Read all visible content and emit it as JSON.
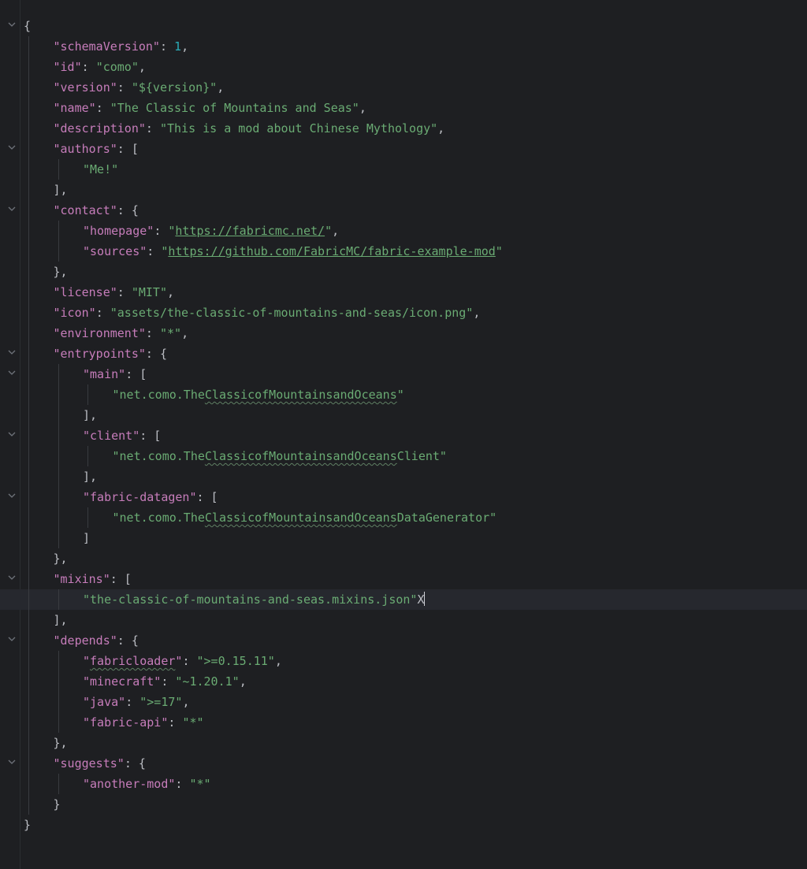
{
  "editor": {
    "theme_colors": {
      "background": "#1e1f22",
      "key": "#c77dbb",
      "string": "#6aab73",
      "number": "#2aacb8",
      "punctuation": "#bcbec4",
      "current_line": "#26282e"
    },
    "fold_icon": "chevron-down-icon",
    "lines": [
      {
        "indent": 0,
        "fold": true,
        "tokens": [
          {
            "t": "{",
            "c": "punc"
          }
        ]
      },
      {
        "indent": 1,
        "tokens": [
          {
            "t": "\"schemaVersion\"",
            "c": "key"
          },
          {
            "t": ": ",
            "c": "punc"
          },
          {
            "t": "1",
            "c": "num"
          },
          {
            "t": ",",
            "c": "punc"
          }
        ]
      },
      {
        "indent": 1,
        "tokens": [
          {
            "t": "\"id\"",
            "c": "key"
          },
          {
            "t": ": ",
            "c": "punc"
          },
          {
            "t": "\"como\"",
            "c": "str"
          },
          {
            "t": ",",
            "c": "punc"
          }
        ]
      },
      {
        "indent": 1,
        "tokens": [
          {
            "t": "\"version\"",
            "c": "key"
          },
          {
            "t": ": ",
            "c": "punc"
          },
          {
            "t": "\"${version}\"",
            "c": "str"
          },
          {
            "t": ",",
            "c": "punc"
          }
        ]
      },
      {
        "indent": 1,
        "tokens": [
          {
            "t": "\"name\"",
            "c": "key"
          },
          {
            "t": ": ",
            "c": "punc"
          },
          {
            "t": "\"The Classic of Mountains and Seas\"",
            "c": "str"
          },
          {
            "t": ",",
            "c": "punc"
          }
        ]
      },
      {
        "indent": 1,
        "tokens": [
          {
            "t": "\"description\"",
            "c": "key"
          },
          {
            "t": ": ",
            "c": "punc"
          },
          {
            "t": "\"This is a mod about Chinese Mythology\"",
            "c": "str"
          },
          {
            "t": ",",
            "c": "punc"
          }
        ]
      },
      {
        "indent": 1,
        "fold": true,
        "tokens": [
          {
            "t": "\"authors\"",
            "c": "key"
          },
          {
            "t": ": [",
            "c": "punc"
          }
        ]
      },
      {
        "indent": 2,
        "tokens": [
          {
            "t": "\"Me!\"",
            "c": "str"
          }
        ]
      },
      {
        "indent": 1,
        "tokens": [
          {
            "t": "],",
            "c": "punc"
          }
        ]
      },
      {
        "indent": 1,
        "fold": true,
        "tokens": [
          {
            "t": "\"contact\"",
            "c": "key"
          },
          {
            "t": ": {",
            "c": "punc"
          }
        ]
      },
      {
        "indent": 2,
        "tokens": [
          {
            "t": "\"homepage\"",
            "c": "key"
          },
          {
            "t": ": ",
            "c": "punc"
          },
          {
            "t": "\"",
            "c": "str"
          },
          {
            "t": "https://fabricmc.net/",
            "c": "str link"
          },
          {
            "t": "\"",
            "c": "str"
          },
          {
            "t": ",",
            "c": "punc"
          }
        ]
      },
      {
        "indent": 2,
        "tokens": [
          {
            "t": "\"sources\"",
            "c": "key"
          },
          {
            "t": ": ",
            "c": "punc"
          },
          {
            "t": "\"",
            "c": "str"
          },
          {
            "t": "https://github.com/FabricMC/fabric-example-mod",
            "c": "str link"
          },
          {
            "t": "\"",
            "c": "str"
          }
        ]
      },
      {
        "indent": 1,
        "tokens": [
          {
            "t": "},",
            "c": "punc"
          }
        ]
      },
      {
        "indent": 1,
        "tokens": [
          {
            "t": "\"license\"",
            "c": "key"
          },
          {
            "t": ": ",
            "c": "punc"
          },
          {
            "t": "\"MIT\"",
            "c": "str"
          },
          {
            "t": ",",
            "c": "punc"
          }
        ]
      },
      {
        "indent": 1,
        "tokens": [
          {
            "t": "\"icon\"",
            "c": "key"
          },
          {
            "t": ": ",
            "c": "punc"
          },
          {
            "t": "\"assets/the-classic-of-mountains-and-seas/icon.png\"",
            "c": "str"
          },
          {
            "t": ",",
            "c": "punc"
          }
        ]
      },
      {
        "indent": 1,
        "tokens": [
          {
            "t": "\"environment\"",
            "c": "key"
          },
          {
            "t": ": ",
            "c": "punc"
          },
          {
            "t": "\"*\"",
            "c": "str"
          },
          {
            "t": ",",
            "c": "punc"
          }
        ]
      },
      {
        "indent": 1,
        "fold": true,
        "tokens": [
          {
            "t": "\"entrypoints\"",
            "c": "key"
          },
          {
            "t": ": {",
            "c": "punc"
          }
        ]
      },
      {
        "indent": 2,
        "fold": true,
        "tokens": [
          {
            "t": "\"main\"",
            "c": "key"
          },
          {
            "t": ": [",
            "c": "punc"
          }
        ]
      },
      {
        "indent": 3,
        "tokens": [
          {
            "t": "\"net.como.The",
            "c": "str"
          },
          {
            "t": "ClassicofMountainsandOceans",
            "c": "str typo"
          },
          {
            "t": "\"",
            "c": "str"
          }
        ]
      },
      {
        "indent": 2,
        "tokens": [
          {
            "t": "],",
            "c": "punc"
          }
        ]
      },
      {
        "indent": 2,
        "fold": true,
        "tokens": [
          {
            "t": "\"client\"",
            "c": "key"
          },
          {
            "t": ": [",
            "c": "punc"
          }
        ]
      },
      {
        "indent": 3,
        "tokens": [
          {
            "t": "\"net.como.The",
            "c": "str"
          },
          {
            "t": "ClassicofMountainsandOceans",
            "c": "str typo"
          },
          {
            "t": "Client\"",
            "c": "str"
          }
        ]
      },
      {
        "indent": 2,
        "tokens": [
          {
            "t": "],",
            "c": "punc"
          }
        ]
      },
      {
        "indent": 2,
        "fold": true,
        "tokens": [
          {
            "t": "\"fabric-datagen\"",
            "c": "key"
          },
          {
            "t": ": [",
            "c": "punc"
          }
        ]
      },
      {
        "indent": 3,
        "tokens": [
          {
            "t": "\"net.como.The",
            "c": "str"
          },
          {
            "t": "ClassicofMountainsandOceans",
            "c": "str typo"
          },
          {
            "t": "DataGenerator\"",
            "c": "str"
          }
        ]
      },
      {
        "indent": 2,
        "tokens": [
          {
            "t": "]",
            "c": "punc"
          }
        ]
      },
      {
        "indent": 1,
        "tokens": [
          {
            "t": "},",
            "c": "punc"
          }
        ]
      },
      {
        "indent": 1,
        "fold": true,
        "tokens": [
          {
            "t": "\"mixins\"",
            "c": "key"
          },
          {
            "t": ": [",
            "c": "punc"
          }
        ]
      },
      {
        "indent": 2,
        "current": true,
        "tokens": [
          {
            "t": "\"the-classic-of-mountains-and-seas.mixins.json\"",
            "c": "str"
          },
          {
            "t": "X",
            "c": "punc"
          },
          {
            "t": "",
            "c": "caret"
          }
        ]
      },
      {
        "indent": 1,
        "tokens": [
          {
            "t": "],",
            "c": "punc"
          }
        ]
      },
      {
        "indent": 1,
        "fold": true,
        "tokens": [
          {
            "t": "\"depends\"",
            "c": "key"
          },
          {
            "t": ": {",
            "c": "punc"
          }
        ]
      },
      {
        "indent": 2,
        "tokens": [
          {
            "t": "\"",
            "c": "key"
          },
          {
            "t": "fabricloader",
            "c": "key typo"
          },
          {
            "t": "\"",
            "c": "key"
          },
          {
            "t": ": ",
            "c": "punc"
          },
          {
            "t": "\">=0.15.11\"",
            "c": "str"
          },
          {
            "t": ",",
            "c": "punc"
          }
        ]
      },
      {
        "indent": 2,
        "tokens": [
          {
            "t": "\"minecraft\"",
            "c": "key"
          },
          {
            "t": ": ",
            "c": "punc"
          },
          {
            "t": "\"~1.20.1\"",
            "c": "str"
          },
          {
            "t": ",",
            "c": "punc"
          }
        ]
      },
      {
        "indent": 2,
        "tokens": [
          {
            "t": "\"java\"",
            "c": "key"
          },
          {
            "t": ": ",
            "c": "punc"
          },
          {
            "t": "\">=17\"",
            "c": "str"
          },
          {
            "t": ",",
            "c": "punc"
          }
        ]
      },
      {
        "indent": 2,
        "tokens": [
          {
            "t": "\"fabric-api\"",
            "c": "key"
          },
          {
            "t": ": ",
            "c": "punc"
          },
          {
            "t": "\"*\"",
            "c": "str"
          }
        ]
      },
      {
        "indent": 1,
        "tokens": [
          {
            "t": "},",
            "c": "punc"
          }
        ]
      },
      {
        "indent": 1,
        "fold": true,
        "tokens": [
          {
            "t": "\"suggests\"",
            "c": "key"
          },
          {
            "t": ": {",
            "c": "punc"
          }
        ]
      },
      {
        "indent": 2,
        "tokens": [
          {
            "t": "\"another-mod\"",
            "c": "key"
          },
          {
            "t": ": ",
            "c": "punc"
          },
          {
            "t": "\"*\"",
            "c": "str"
          }
        ]
      },
      {
        "indent": 1,
        "tokens": [
          {
            "t": "}",
            "c": "punc"
          }
        ]
      },
      {
        "indent": 0,
        "tokens": [
          {
            "t": "}",
            "c": "punc"
          }
        ]
      }
    ]
  }
}
